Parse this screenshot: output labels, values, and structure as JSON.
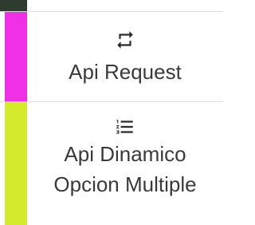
{
  "colors": {
    "top_accent": "#2e3b2f",
    "api_request_stripe": "#f030e6",
    "api_dinamico_stripe": "#d4ea2c",
    "text": "#3a3a3a",
    "divider": "#dcdcdc"
  },
  "items": [
    {
      "icon": "repeat-icon",
      "label": "Api Request"
    },
    {
      "icon": "numbered-list-icon",
      "label_line1": "Api Dinamico",
      "label_line2": "Opcion Multiple"
    }
  ]
}
